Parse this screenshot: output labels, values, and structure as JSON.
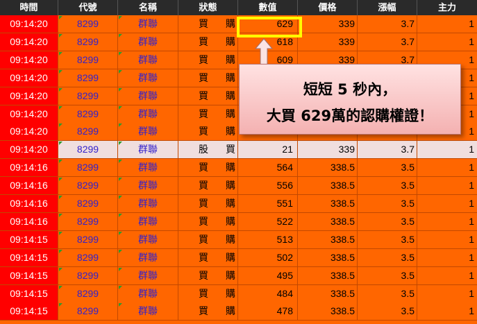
{
  "headers": [
    "時間",
    "代號",
    "名稱",
    "狀態",
    "數值",
    "價格",
    "漲幅",
    "主力"
  ],
  "rows": [
    {
      "time": "09:14:20",
      "code": "8299",
      "name": "群聯",
      "s1": "買",
      "s2": "購",
      "value": "629",
      "price": "339",
      "change": "3.7",
      "main": "1"
    },
    {
      "time": "09:14:20",
      "code": "8299",
      "name": "群聯",
      "s1": "買",
      "s2": "購",
      "value": "618",
      "price": "339",
      "change": "3.7",
      "main": "1"
    },
    {
      "time": "09:14:20",
      "code": "8299",
      "name": "群聯",
      "s1": "買",
      "s2": "購",
      "value": "609",
      "price": "339",
      "change": "3.7",
      "main": "1"
    },
    {
      "time": "09:14:20",
      "code": "8299",
      "name": "群聯",
      "s1": "買",
      "s2": "購",
      "value": "",
      "price": "",
      "change": "",
      "main": "1"
    },
    {
      "time": "09:14:20",
      "code": "8299",
      "name": "群聯",
      "s1": "買",
      "s2": "購",
      "value": "",
      "price": "",
      "change": "",
      "main": "1"
    },
    {
      "time": "09:14:20",
      "code": "8299",
      "name": "群聯",
      "s1": "買",
      "s2": "購",
      "value": "",
      "price": "",
      "change": "",
      "main": "1"
    },
    {
      "time": "09:14:20",
      "code": "8299",
      "name": "群聯",
      "s1": "買",
      "s2": "購",
      "value": "",
      "price": "",
      "change": "",
      "main": "1"
    },
    {
      "time": "09:14:20",
      "code": "8299",
      "name": "群聯",
      "s1": "股",
      "s2": "買",
      "value": "21",
      "price": "339",
      "change": "3.7",
      "main": "1",
      "alt": true
    },
    {
      "time": "09:14:16",
      "code": "8299",
      "name": "群聯",
      "s1": "買",
      "s2": "購",
      "value": "564",
      "price": "338.5",
      "change": "3.5",
      "main": "1"
    },
    {
      "time": "09:14:16",
      "code": "8299",
      "name": "群聯",
      "s1": "買",
      "s2": "購",
      "value": "556",
      "price": "338.5",
      "change": "3.5",
      "main": "1"
    },
    {
      "time": "09:14:16",
      "code": "8299",
      "name": "群聯",
      "s1": "買",
      "s2": "購",
      "value": "551",
      "price": "338.5",
      "change": "3.5",
      "main": "1"
    },
    {
      "time": "09:14:16",
      "code": "8299",
      "name": "群聯",
      "s1": "買",
      "s2": "購",
      "value": "522",
      "price": "338.5",
      "change": "3.5",
      "main": "1"
    },
    {
      "time": "09:14:15",
      "code": "8299",
      "name": "群聯",
      "s1": "買",
      "s2": "購",
      "value": "513",
      "price": "338.5",
      "change": "3.5",
      "main": "1"
    },
    {
      "time": "09:14:15",
      "code": "8299",
      "name": "群聯",
      "s1": "買",
      "s2": "購",
      "value": "502",
      "price": "338.5",
      "change": "3.5",
      "main": "1"
    },
    {
      "time": "09:14:15",
      "code": "8299",
      "name": "群聯",
      "s1": "買",
      "s2": "購",
      "value": "495",
      "price": "338.5",
      "change": "3.5",
      "main": "1"
    },
    {
      "time": "09:14:15",
      "code": "8299",
      "name": "群聯",
      "s1": "買",
      "s2": "購",
      "value": "484",
      "price": "338.5",
      "change": "3.5",
      "main": "1"
    },
    {
      "time": "09:14:15",
      "code": "8299",
      "name": "群聯",
      "s1": "買",
      "s2": "購",
      "value": "478",
      "price": "338.5",
      "change": "3.5",
      "main": "1"
    }
  ],
  "callout": {
    "line1": "短短 5 秒內，",
    "line2": "大買 629萬的認購權證！"
  },
  "colors": {
    "row_bg": "#ff6600",
    "time_bg": "#ff0000",
    "alt_row_bg": "#f0dede",
    "header_bg": "#2a2a2a",
    "highlight_border": "#ffff00",
    "callout_bg": "#f9c8c8",
    "link_text": "#3322cc",
    "flag": "#2d9a2d"
  }
}
